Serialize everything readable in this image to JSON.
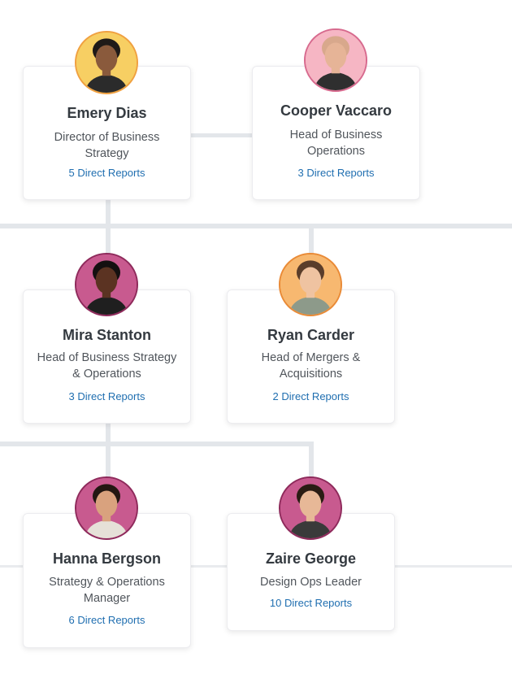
{
  "people": [
    {
      "name": "Emery Dias",
      "title": "Director of Business Strategy",
      "reports": "5 Direct Reports",
      "avatar_bg": "#f7cf63",
      "avatar_ring": "#f0a040",
      "skin": "#8a5a3c",
      "hair": "#1f1a18",
      "shirt": "#2b2b2b"
    },
    {
      "name": "Cooper Vaccaro",
      "title": "Head of Business Operations",
      "reports": "3 Direct Reports",
      "avatar_bg": "#f6b6c4",
      "avatar_ring": "#d76a8e",
      "skin": "#e6b497",
      "hair": "#d8a88c",
      "shirt": "#2f2f2f"
    },
    {
      "name": "Mira Stanton",
      "title": "Head of Business Strategy & Operations",
      "reports": "3 Direct Reports",
      "avatar_bg": "#c85a8f",
      "avatar_ring": "#8e2a5b",
      "skin": "#5b3322",
      "hair": "#141010",
      "shirt": "#1f1f1f"
    },
    {
      "name": "Ryan Carder",
      "title": "Head of Mergers & Acquisitions",
      "reports": "2 Direct Reports",
      "avatar_bg": "#f7b870",
      "avatar_ring": "#e98a36",
      "skin": "#efc3a1",
      "hair": "#5a3d2a",
      "shirt": "#8d9a8a"
    },
    {
      "name": "Hanna Bergson",
      "title": "Strategy & Operations Manager",
      "reports": "6 Direct Reports",
      "avatar_bg": "#c85a8f",
      "avatar_ring": "#8e2a5b",
      "skin": "#d9a27e",
      "hair": "#231712",
      "shirt": "#e6e1d8"
    },
    {
      "name": "Zaire George",
      "title": "Design Ops Leader",
      "reports": "10 Direct Reports",
      "avatar_bg": "#c85a8f",
      "avatar_ring": "#8e2a5b",
      "skin": "#e7b897",
      "hair": "#2a1c14",
      "shirt": "#3a3a3a"
    }
  ]
}
